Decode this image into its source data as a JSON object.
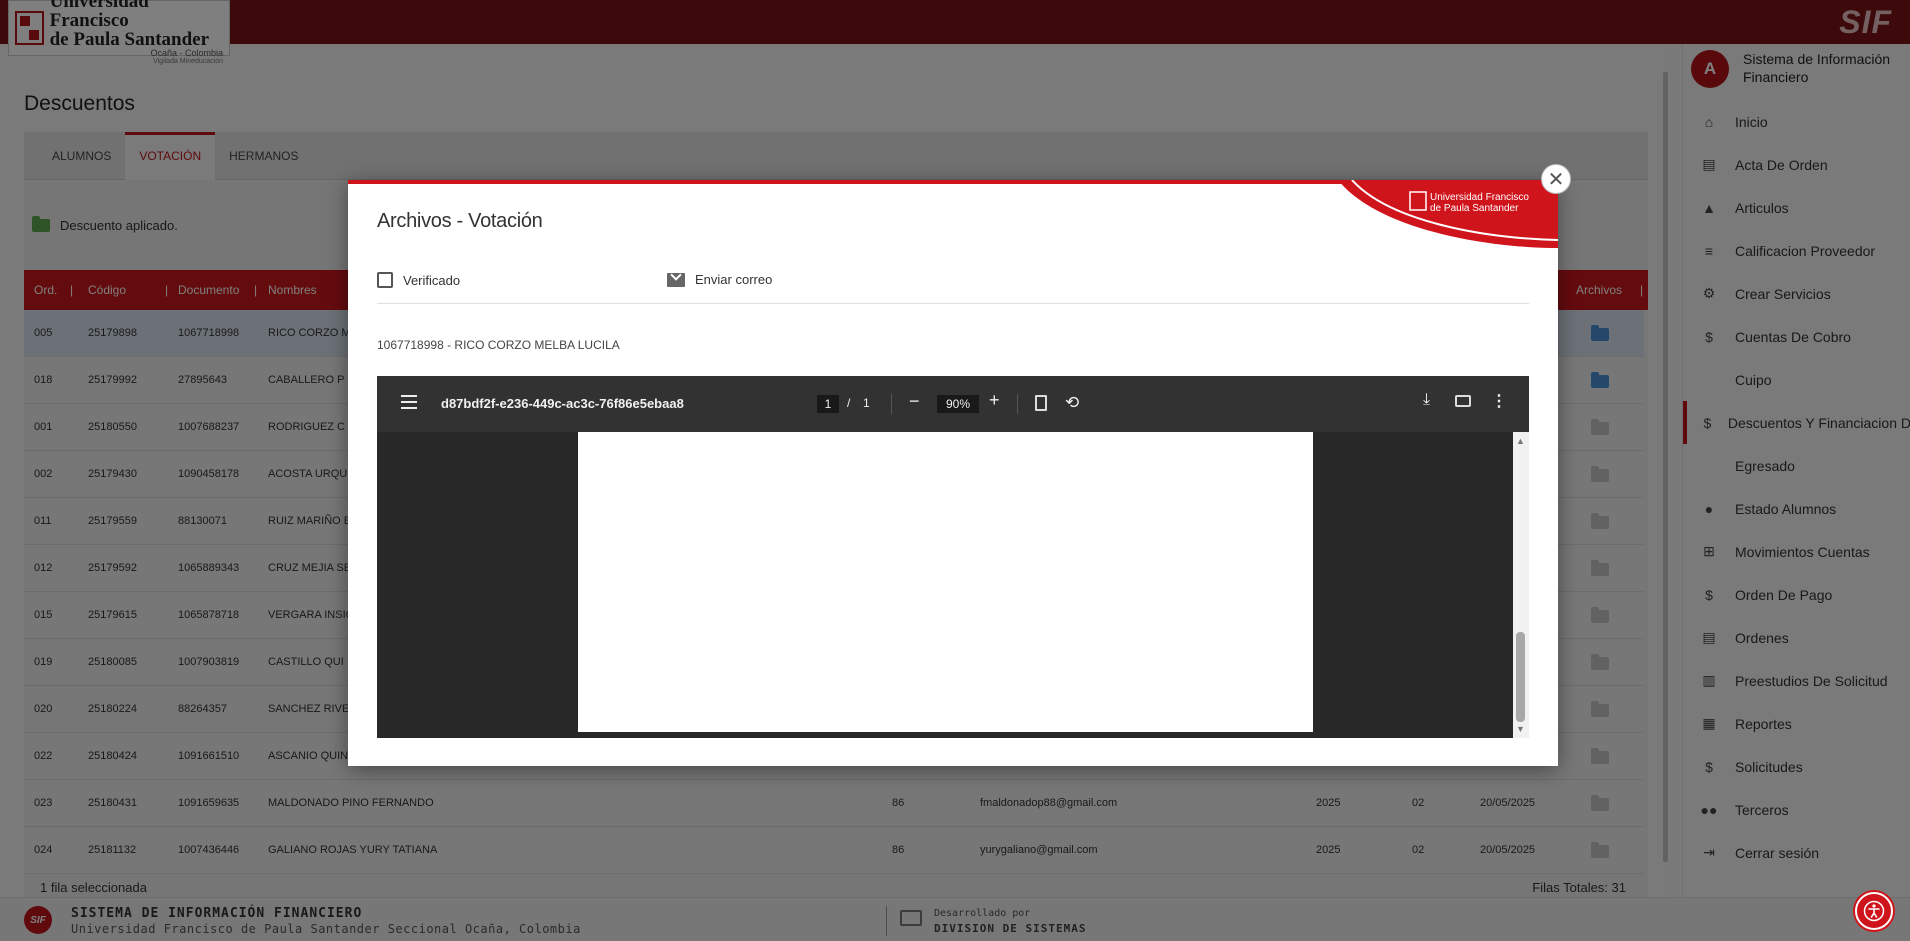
{
  "header": {
    "logo_line1": "Universidad Francisco",
    "logo_line2": "de Paula Santander",
    "logo_line3": "Ocaña - Colombia",
    "logo_line4": "Vigilada Mineducación",
    "brand": "SIF"
  },
  "page": {
    "title": "Descuentos",
    "tabs": [
      {
        "label": "ALUMNOS",
        "active": false
      },
      {
        "label": "VOTACIÓN",
        "active": true
      },
      {
        "label": "HERMANOS",
        "active": false
      }
    ],
    "discount_note": "Descuento aplicado.",
    "columns": {
      "ord": "Ord.",
      "codigo": "Código",
      "documento": "Documento",
      "nombres": "Nombres",
      "archivos": "Archivos"
    },
    "rows": [
      {
        "ord": "005",
        "codigo": "25179898",
        "documento": "1067718998",
        "nombres": "RICO CORZO M",
        "edad": "",
        "correo": "",
        "anio": "",
        "periodo": "",
        "fecha": "",
        "selected": true,
        "folder": "blue"
      },
      {
        "ord": "018",
        "codigo": "25179992",
        "documento": "27895643",
        "nombres": "CABALLERO P",
        "edad": "",
        "correo": "",
        "anio": "",
        "periodo": "",
        "fecha": "",
        "selected": false,
        "folder": "blue"
      },
      {
        "ord": "001",
        "codigo": "25180550",
        "documento": "1007688237",
        "nombres": "RODRIGUEZ C",
        "edad": "",
        "correo": "",
        "anio": "",
        "periodo": "",
        "fecha": "",
        "selected": false,
        "folder": "grey"
      },
      {
        "ord": "002",
        "codigo": "25179430",
        "documento": "1090458178",
        "nombres": "ACOSTA URQU",
        "edad": "",
        "correo": "",
        "anio": "",
        "periodo": "",
        "fecha": "",
        "selected": false,
        "folder": "grey"
      },
      {
        "ord": "011",
        "codigo": "25179559",
        "documento": "88130071",
        "nombres": "RUIZ MARIÑO E",
        "edad": "",
        "correo": "",
        "anio": "",
        "periodo": "",
        "fecha": "",
        "selected": false,
        "folder": "grey"
      },
      {
        "ord": "012",
        "codigo": "25179592",
        "documento": "1065889343",
        "nombres": "CRUZ MEJIA SE",
        "edad": "",
        "correo": "",
        "anio": "",
        "periodo": "",
        "fecha": "",
        "selected": false,
        "folder": "grey"
      },
      {
        "ord": "015",
        "codigo": "25179615",
        "documento": "1065878718",
        "nombres": "VERGARA INSIG",
        "edad": "",
        "correo": "",
        "anio": "",
        "periodo": "",
        "fecha": "",
        "selected": false,
        "folder": "grey"
      },
      {
        "ord": "019",
        "codigo": "25180085",
        "documento": "1007903819",
        "nombres": "CASTILLO QUI",
        "edad": "",
        "correo": "",
        "anio": "",
        "periodo": "",
        "fecha": "",
        "selected": false,
        "folder": "grey"
      },
      {
        "ord": "020",
        "codigo": "25180224",
        "documento": "88264357",
        "nombres": "SANCHEZ RIVE",
        "edad": "",
        "correo": "",
        "anio": "",
        "periodo": "",
        "fecha": "",
        "selected": false,
        "folder": "grey"
      },
      {
        "ord": "022",
        "codigo": "25180424",
        "documento": "1091661510",
        "nombres": "ASCANIO QUIN",
        "edad": "",
        "correo": "",
        "anio": "",
        "periodo": "",
        "fecha": "",
        "selected": false,
        "folder": "grey"
      },
      {
        "ord": "023",
        "codigo": "25180431",
        "documento": "1091659635",
        "nombres": "MALDONADO PINO FERNANDO",
        "edad": "86",
        "correo": "fmaldonadop88@gmail.com",
        "anio": "2025",
        "periodo": "02",
        "fecha": "20/05/2025",
        "selected": false,
        "folder": "grey"
      },
      {
        "ord": "024",
        "codigo": "25181132",
        "documento": "1007436446",
        "nombres": "GALIANO ROJAS YURY TATIANA",
        "edad": "86",
        "correo": "yurygaliano@gmail.com",
        "anio": "2025",
        "periodo": "02",
        "fecha": "20/05/2025",
        "selected": false,
        "folder": "grey"
      }
    ],
    "footer_selected": "1 fila seleccionada",
    "footer_total": "Filas Totales: 31"
  },
  "sidebar": {
    "avatar": "A",
    "title": "Sistema de Información Financiero",
    "items": [
      {
        "label": "Inicio",
        "icon": "home-icon",
        "glyph": "⌂"
      },
      {
        "label": "Acta De Orden",
        "icon": "document-copy-icon",
        "glyph": "▤"
      },
      {
        "label": "Articulos",
        "icon": "shapes-icon",
        "glyph": "▲"
      },
      {
        "label": "Calificacion Proveedor",
        "icon": "rating-icon",
        "glyph": "≡"
      },
      {
        "label": "Crear Servicios",
        "icon": "gears-icon",
        "glyph": "⚙"
      },
      {
        "label": "Cuentas De Cobro",
        "icon": "money-icon",
        "glyph": "$"
      },
      {
        "label": "Cuipo",
        "icon": "",
        "glyph": ""
      },
      {
        "label": "Descuentos Y Financiacion D",
        "icon": "discount-icon",
        "glyph": "$"
      },
      {
        "label": "Egresado",
        "icon": "",
        "glyph": ""
      },
      {
        "label": "Estado Alumnos",
        "icon": "person-icon",
        "glyph": "●"
      },
      {
        "label": "Movimientos Cuentas",
        "icon": "tree-icon",
        "glyph": "⊞"
      },
      {
        "label": "Orden De Pago",
        "icon": "invoice-icon",
        "glyph": "$"
      },
      {
        "label": "Ordenes",
        "icon": "list-document-icon",
        "glyph": "▤"
      },
      {
        "label": "Preestudios De Solicitud",
        "icon": "chart-doc-icon",
        "glyph": "▥"
      },
      {
        "label": "Reportes",
        "icon": "bar-chart-icon",
        "glyph": "▦"
      },
      {
        "label": "Solicitudes",
        "icon": "invoice-dollar-icon",
        "glyph": "$"
      },
      {
        "label": "Terceros",
        "icon": "people-icon",
        "glyph": "●●"
      },
      {
        "label": "Cerrar sesión",
        "icon": "logout-icon",
        "glyph": "⇥"
      }
    ],
    "active_index": 7
  },
  "modal": {
    "title": "Archivos - Votación",
    "verified_label": "Verificado",
    "send_email_label": "Enviar correo",
    "record": "1067718998 - RICO CORZO MELBA LUCILA",
    "corner_logo_line1": "Universidad Francisco",
    "corner_logo_line2": "de Paula Santander",
    "close_glyph": "✕"
  },
  "pdf": {
    "filename": "d87bdf2f-e236-449c-ac3c-76f86e5ebaa8",
    "page_current": "1",
    "page_separator": "/",
    "page_total": "1",
    "zoom": "90%",
    "minus": "−",
    "plus": "+",
    "rotate": "⟲",
    "download": "⤓",
    "more": "⋮",
    "scroll_up": "▲",
    "scroll_down": "▼"
  },
  "footer": {
    "title": "SISTEMA DE INFORMACIÓN FINANCIERO",
    "subtitle": "Universidad Francisco de Paula Santander Seccional Ocaña, Colombia",
    "dev_label": "Desarrollado por",
    "dev_name": "DIVISION DE SISTEMAS",
    "logo": "SIF"
  },
  "colors": {
    "brand_red": "#c0141a",
    "topbar": "#7d1315",
    "folder_blue": "#4b8fd3",
    "folder_green": "#5aa64e"
  }
}
